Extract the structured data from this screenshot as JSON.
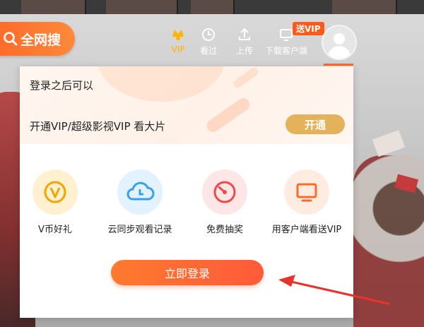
{
  "search": {
    "label": "全网搜"
  },
  "nav": [
    {
      "label": "VIP",
      "icon": "crown-icon",
      "color": "#ffb400"
    },
    {
      "label": "看过",
      "icon": "clock-icon"
    },
    {
      "label": "上传",
      "icon": "upload-icon"
    },
    {
      "label": "下载客户端",
      "icon": "monitor-icon"
    }
  ],
  "vip_tag": "送VIP",
  "panel": {
    "login_hint": "登录之后可以",
    "vip_promo": "开通VIP/超级影视VIP 看大片",
    "open_button": "开通",
    "features": [
      {
        "label": "V币好礼",
        "icon": "v-coin-icon"
      },
      {
        "label": "云同步观看记录",
        "icon": "cloud-sync-icon"
      },
      {
        "label": "免费抽奖",
        "icon": "lottery-icon"
      },
      {
        "label": "用客户端看送VIP",
        "icon": "tv-icon"
      }
    ],
    "login_button": "立即登录"
  },
  "colors": {
    "accent": "#ff6a2a",
    "gold": "#e3b25a",
    "annotation_arrow": "#e8332a"
  }
}
